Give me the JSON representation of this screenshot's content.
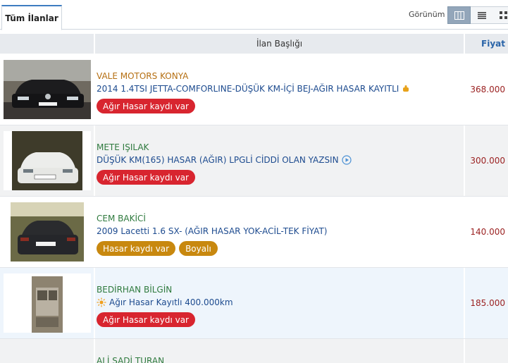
{
  "tabs": {
    "active_label": "Tüm İlanlar"
  },
  "view": {
    "label": "Görünüm",
    "modes": [
      "table-view-icon",
      "list-view-icon",
      "grid-view-icon"
    ]
  },
  "table": {
    "headers": {
      "title": "İlan Başlığı",
      "price": "Fiyat"
    }
  },
  "listings": [
    {
      "seller": "VALE MOTORS KONYA",
      "title": "2014 1.4TSI JETTA-COMFORLINE-DÜŞÜK KM-İÇİ BEJ-AĞIR HASAR KAYITLI",
      "badges": [
        "Ağır Hasar kaydı var"
      ],
      "price": "368.000"
    },
    {
      "seller": "METE IŞILAK",
      "title": "DÜŞÜK KM(165) HASAR (AĞIR) LPGLİ CİDDİ OLAN YAZSIN",
      "badges": [
        "Ağır Hasar kaydı var"
      ],
      "price": "300.000"
    },
    {
      "seller": "CEM BAKİCİ",
      "title": "2009 Lacetti 1.6 SX- (AĞIR HASAR YOK-ACİL-TEK FİYAT)",
      "badges": [
        "Hasar kaydı var",
        "Boyalı"
      ],
      "price": "140.000"
    },
    {
      "seller": "BEDİRHAN BİLGİN",
      "title": "Ağır Hasar Kayıtlı 400.000km",
      "badges": [
        "Ağır Hasar kaydı var"
      ],
      "price": "185.000"
    },
    {
      "seller": "ALİ SADİ TURAN"
    }
  ],
  "colors": {
    "accent": "#3d7cc1",
    "badge_red": "#d8252f",
    "badge_gold": "#c8880f",
    "price": "#9a1f1f"
  }
}
